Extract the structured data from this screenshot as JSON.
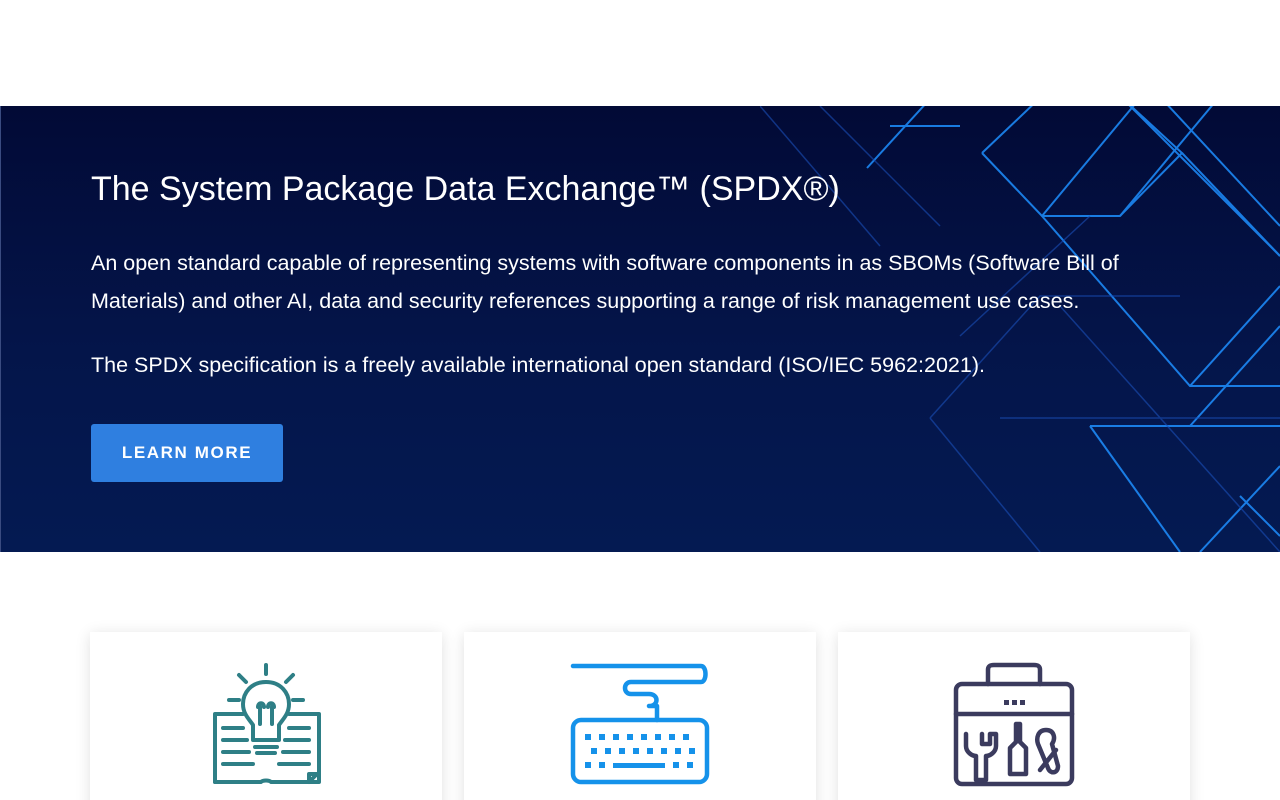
{
  "hero": {
    "title": "The System Package Data Exchange™ (SPDX®)",
    "description": "An open standard capable of representing systems with software components in as SBOMs (Software Bill of Materials) and other AI, data and security references supporting a range of risk management use cases.",
    "note": "The SPDX specification is a freely available international open standard (ISO/IEC 5962:2021).",
    "button_label": "LEARN MORE"
  },
  "cards": [
    {
      "icon": "book-lightbulb-icon",
      "color": "#2e7f86"
    },
    {
      "icon": "keyboard-icon",
      "color": "#1592ea"
    },
    {
      "icon": "toolbox-icon",
      "color": "#3b3b5e"
    }
  ],
  "colors": {
    "hero_bg": "#03103f",
    "accent": "#2f7fe0",
    "pattern_line": "#1e8fff"
  }
}
